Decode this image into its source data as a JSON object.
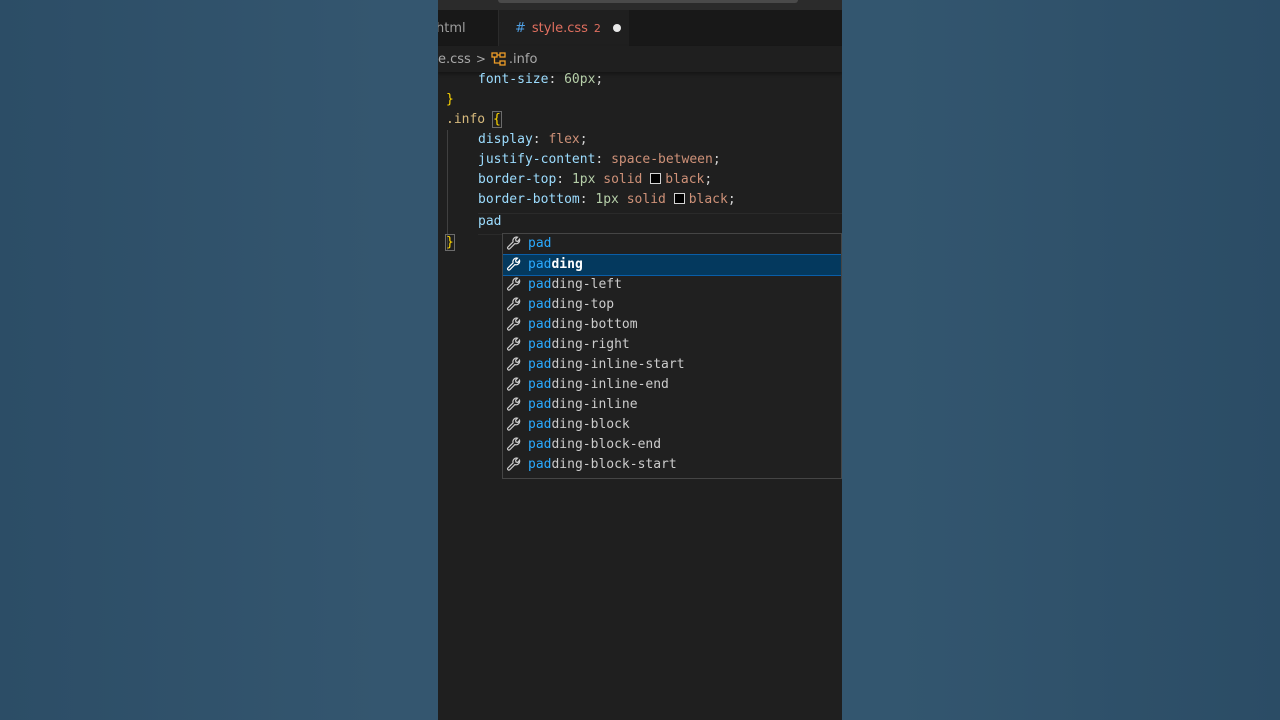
{
  "tabs": [
    {
      "label": "html",
      "active": false
    },
    {
      "label": "style.css",
      "problems": "2",
      "unsaved": true,
      "active": true
    }
  ],
  "breadcrumb": {
    "file": "e.css",
    "separator": ">",
    "symbol": ".info"
  },
  "code": {
    "line1": {
      "prop": "font-size",
      "colon": ": ",
      "num": "60px",
      "semi": ";"
    },
    "line2": {
      "brace": "}"
    },
    "line3": {
      "selector": ".info",
      "brace": "{"
    },
    "line4": {
      "prop": "display",
      "colon": ": ",
      "val": "flex",
      "semi": ";"
    },
    "line5": {
      "prop": "justify-content",
      "colon": ": ",
      "val": "space-between",
      "semi": ";"
    },
    "line6": {
      "prop": "border-top",
      "colon": ": ",
      "num": "1px",
      "val1": "solid",
      "val2": "black",
      "semi": ";"
    },
    "line7": {
      "prop": "border-bottom",
      "colon": ": ",
      "num": "1px",
      "val1": "solid",
      "val2": "black",
      "semi": ";"
    },
    "line8": {
      "typed": "pad"
    },
    "line9": {
      "brace": "}"
    }
  },
  "suggest": {
    "typed": "pad",
    "items": [
      {
        "match": "pad",
        "rest": ""
      },
      {
        "match": "pad",
        "rest": "ding"
      },
      {
        "match": "pad",
        "rest": "ding-left"
      },
      {
        "match": "pad",
        "rest": "ding-top"
      },
      {
        "match": "pad",
        "rest": "ding-bottom"
      },
      {
        "match": "pad",
        "rest": "ding-right"
      },
      {
        "match": "pad",
        "rest": "ding-inline-start"
      },
      {
        "match": "pad",
        "rest": "ding-inline-end"
      },
      {
        "match": "pad",
        "rest": "ding-inline"
      },
      {
        "match": "pad",
        "rest": "ding-block"
      },
      {
        "match": "pad",
        "rest": "ding-block-end"
      },
      {
        "match": "pad",
        "rest": "ding-block-start"
      }
    ],
    "selected_index": 1,
    "item_icon": "wrench-icon"
  },
  "colors": {
    "accent": "#04395e",
    "match": "#2aaaff",
    "tab_error": "#e06f5f"
  }
}
